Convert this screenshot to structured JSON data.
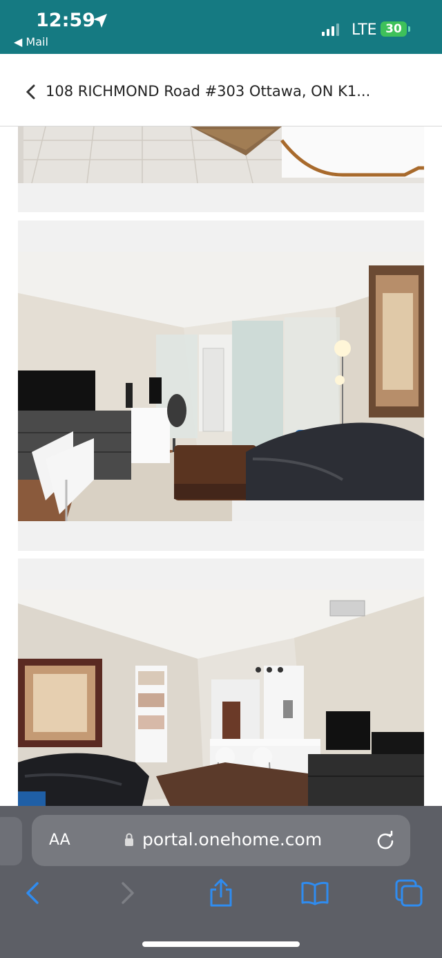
{
  "status": {
    "time": "12:59",
    "back_app": "◀ Mail",
    "network": "LTE",
    "battery": "30"
  },
  "header": {
    "title": "108 RICHMOND Road #303 Ottawa, ON K1..."
  },
  "browser": {
    "aa": "AA",
    "url": "portal.onehome.com"
  },
  "icons": [
    "location-arrow-icon",
    "signal-icon",
    "battery-icon",
    "chevron-left-icon",
    "lock-icon",
    "reload-icon",
    "back-icon",
    "forward-icon",
    "share-icon",
    "bookmarks-icon",
    "tabs-icon"
  ],
  "colors": {
    "status_bar": "#157a82",
    "browser_chrome": "#5d5f66",
    "toolbar_accent": "#2f8cf0",
    "battery": "#3ec15a"
  }
}
